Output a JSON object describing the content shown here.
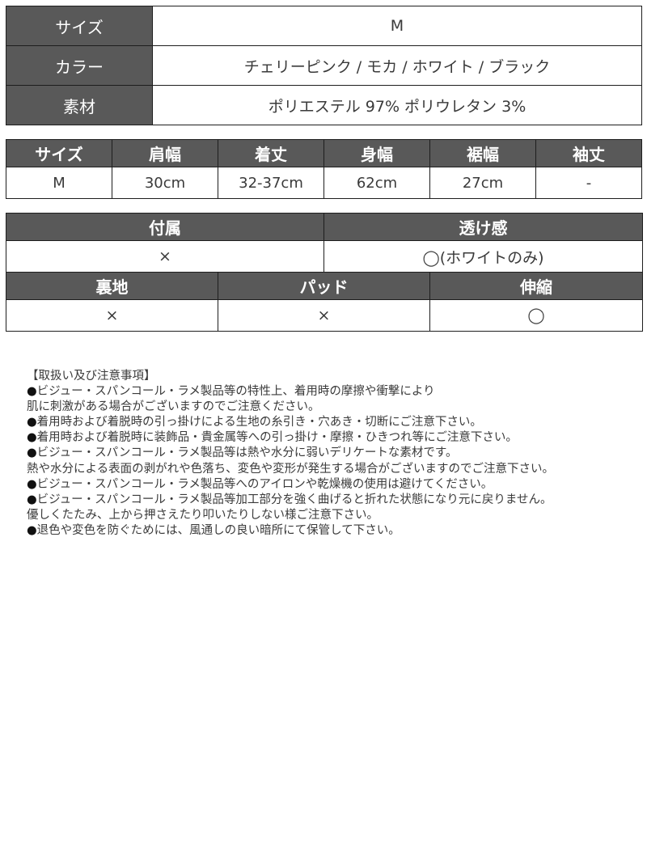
{
  "spec_table": {
    "rows": [
      {
        "label": "サイズ",
        "value": "M"
      },
      {
        "label": "カラー",
        "value": "チェリーピンク / モカ / ホワイト / ブラック"
      },
      {
        "label": "素材",
        "value": "ポリエステル 97%  ポリウレタン 3%"
      }
    ]
  },
  "size_table": {
    "headers": [
      "サイズ",
      "肩幅",
      "着丈",
      "身幅",
      "裾幅",
      "袖丈"
    ],
    "rows": [
      [
        "M",
        "30cm",
        "32-37cm",
        "62cm",
        "27cm",
        "-"
      ]
    ]
  },
  "attr_table": {
    "section1": {
      "headers": [
        "付属",
        "透け感"
      ],
      "values": [
        "×",
        "◯(ホワイトのみ)"
      ]
    },
    "section2": {
      "headers": [
        "裏地",
        "パッド",
        "伸縮"
      ],
      "values": [
        "×",
        "×",
        "◯"
      ]
    }
  },
  "notes": {
    "title": "【取扱い及び注意事項】",
    "bullet": "●",
    "lines": [
      {
        "bullet": true,
        "text": "ビジュー・スパンコール・ラメ製品等の特性上、着用時の摩擦や衝撃により"
      },
      {
        "bullet": false,
        "text": "肌に刺激がある場合がございますのでご注意ください。"
      },
      {
        "bullet": true,
        "text": "着用時および着脱時の引っ掛けによる生地の糸引き・穴あき・切断にご注意下さい。"
      },
      {
        "bullet": true,
        "text": "着用時および着脱時に装飾品・貴金属等への引っ掛け・摩擦・ひきつれ等にご注意下さい。"
      },
      {
        "bullet": true,
        "text": "ビジュー・スパンコール・ラメ製品等は熱や水分に弱いデリケートな素材です。"
      },
      {
        "bullet": false,
        "text": "熱や水分による表面の剥がれや色落ち、変色や変形が発生する場合がございますのでご注意下さい。"
      },
      {
        "bullet": true,
        "text": "ビジュー・スパンコール・ラメ製品等へのアイロンや乾燥機の使用は避けてください。"
      },
      {
        "bullet": true,
        "text": "ビジュー・スパンコール・ラメ製品等加工部分を強く曲げると折れた状態になり元に戻りません。"
      },
      {
        "bullet": false,
        "text": "優しくたたみ、上から押さえたり叩いたりしない様ご注意下さい。"
      },
      {
        "bullet": true,
        "text": "退色や変色を防ぐためには、風通しの良い暗所にて保管して下さい。"
      }
    ]
  }
}
